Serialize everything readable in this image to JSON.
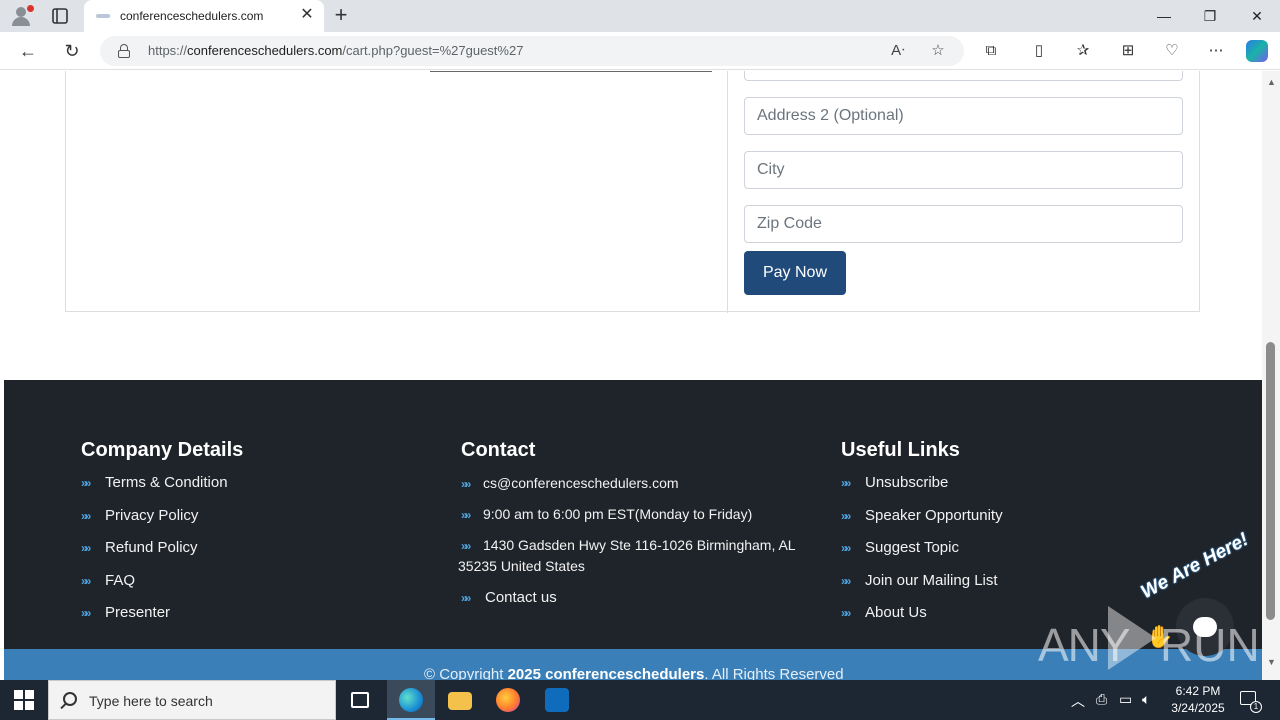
{
  "browser": {
    "tab_title": "conferenceschedulers.com",
    "url_prefix": "https://",
    "url_domain": "conferenceschedulers.com",
    "url_path": "/cart.php?guest=%27guest%27",
    "new_tab_symbol": "+",
    "close_tab_symbol": "✕"
  },
  "checkout": {
    "address2_placeholder": "Address 2 (Optional)",
    "city_placeholder": "City",
    "zip_placeholder": "Zip Code",
    "pay_button": "Pay Now"
  },
  "footer": {
    "company": {
      "heading": "Company Details",
      "links": [
        "Terms & Condition",
        "Privacy Policy",
        "Refund Policy",
        "FAQ",
        "Presenter"
      ]
    },
    "contact": {
      "heading": "Contact",
      "email": "cs@conferenceschedulers.com",
      "hours": "9:00 am to 6:00 pm EST(Monday to Friday)",
      "address_line1": "1430 Gadsden Hwy Ste 116-1026 Birmingham, AL",
      "address_line2": "35235 United States",
      "contact_link": "Contact us"
    },
    "useful": {
      "heading": "Useful Links",
      "links": [
        "Unsubscribe",
        "Speaker Opportunity",
        "Suggest Topic",
        "Join our Mailing List",
        "About Us"
      ]
    },
    "copyright_prefix": "© Copyright ",
    "copyright_bold": "2025 conferenceschedulers",
    "copyright_suffix": ". All Rights Reserved"
  },
  "chat": {
    "label": "We Are Here!"
  },
  "watermark": {
    "left": "ANY",
    "right": "RUN"
  },
  "taskbar": {
    "search_placeholder": "Type here to search",
    "time": "6:42 PM",
    "date": "3/24/2025",
    "notification_count": "1"
  },
  "colors": {
    "footer_bg": "#1f242a",
    "pay_button": "#1f4a7a",
    "copyright_bar": "#3a7fb8",
    "link_arrow": "#4ba3e0"
  }
}
